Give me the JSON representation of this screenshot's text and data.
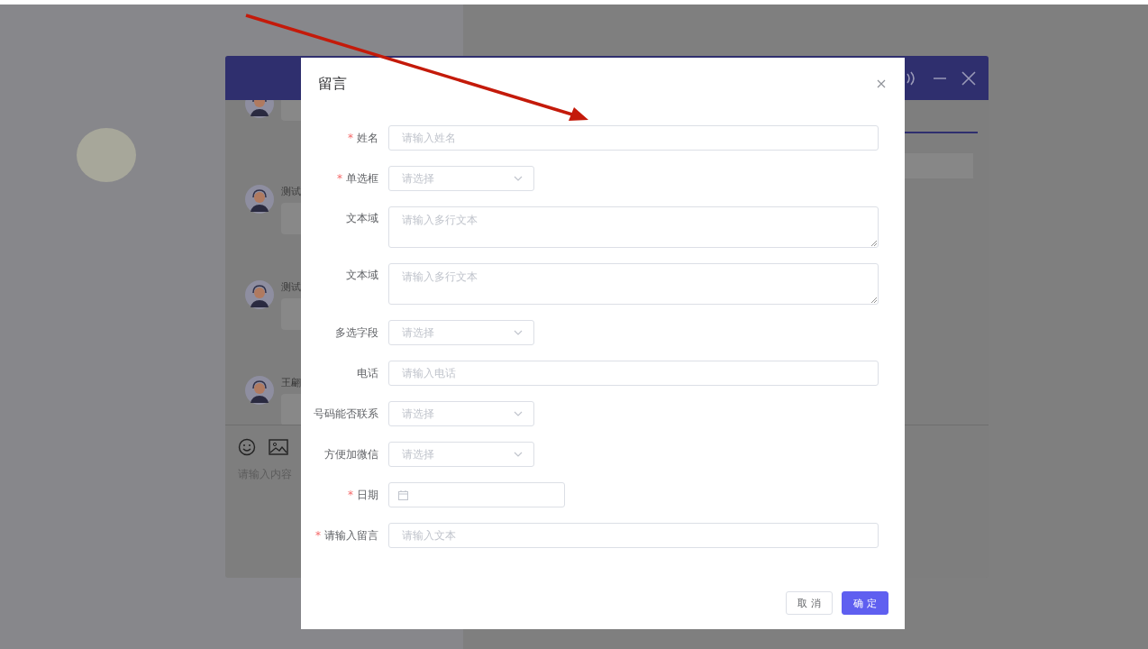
{
  "chat_window": {
    "messages": [
      {
        "kind": "bubble"
      },
      {
        "kind": "bubble",
        "name": "测试"
      },
      {
        "kind": "bubble",
        "name": "测试"
      },
      {
        "kind": "bubble",
        "name": "王翩"
      }
    ],
    "input_placeholder": "请输入内容"
  },
  "dialog": {
    "title": "留言",
    "required_mark": "*",
    "fields": [
      {
        "kind": "input",
        "label": "姓名",
        "required": true,
        "placeholder": "请输入姓名"
      },
      {
        "kind": "select",
        "label": "单选框",
        "required": true,
        "placeholder": "请选择"
      },
      {
        "kind": "textarea",
        "label": "文本域",
        "required": false,
        "placeholder": "请输入多行文本"
      },
      {
        "kind": "textarea",
        "label": "文本域",
        "required": false,
        "placeholder": "请输入多行文本"
      },
      {
        "kind": "select",
        "label": "多选字段",
        "required": false,
        "placeholder": "请选择"
      },
      {
        "kind": "input",
        "label": "电话",
        "required": false,
        "placeholder": "请输入电话"
      },
      {
        "kind": "select",
        "label": "号码能否联系",
        "required": false,
        "placeholder": "请选择"
      },
      {
        "kind": "select",
        "label": "方便加微信",
        "required": false,
        "placeholder": "请选择"
      },
      {
        "kind": "date",
        "label": "日期",
        "required": true
      },
      {
        "kind": "input",
        "label": "请输入留言",
        "required": true,
        "placeholder": "请输入文本"
      }
    ],
    "buttons": [
      {
        "kind": "secondary",
        "label": "取 消"
      },
      {
        "kind": "primary",
        "label": "确 定"
      }
    ]
  },
  "annotation": {
    "kind": "arrow"
  }
}
